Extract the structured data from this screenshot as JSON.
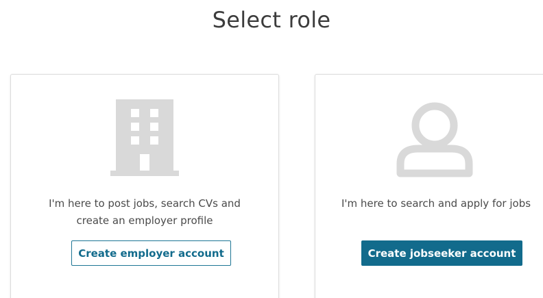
{
  "page": {
    "title": "Select role"
  },
  "cards": {
    "employer": {
      "icon": "building-icon",
      "description_line1": "I'm here to post jobs, search CVs and",
      "description_line2": "create an employer profile",
      "button_label": "Create employer account"
    },
    "jobseeker": {
      "icon": "user-icon",
      "description": "I'm here to search and apply for jobs",
      "button_label": "Create jobseeker account"
    }
  },
  "colors": {
    "accent": "#126b8c",
    "icon_gray": "#d9d9d9",
    "card_border": "#dcdcdc"
  }
}
